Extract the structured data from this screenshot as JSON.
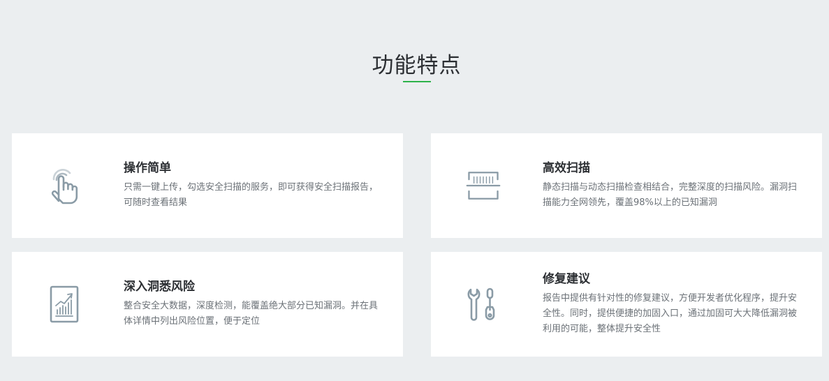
{
  "section": {
    "title": "功能特点"
  },
  "colors": {
    "accent": "#2db34a",
    "icon": "#8a9ba6",
    "background": "#ebeef0",
    "card": "#ffffff"
  },
  "features": [
    {
      "icon": "tap-finger-icon",
      "title": "操作简单",
      "desc": "只需一键上传，勾选安全扫描的服务，即可获得安全扫描报告，可随时查看结果"
    },
    {
      "icon": "scanner-icon",
      "title": "高效扫描",
      "desc": "静态扫描与动态扫描检查相结合，完整深度的扫描风险。漏洞扫描能力全网领先，覆盖98%以上的已知漏洞"
    },
    {
      "icon": "chart-report-icon",
      "title": "深入洞悉风险",
      "desc": "整合安全大数据，深度检测，能覆盖绝大部分已知漏洞。并在具体详情中列出风险位置，便于定位"
    },
    {
      "icon": "wrench-tools-icon",
      "title": "修复建议",
      "desc": "报告中提供有针对性的修复建议，方便开发者优化程序，提升安全性。同时，提供便捷的加固入口，通过加固可大大降低漏洞被利用的可能，整体提升安全性"
    }
  ]
}
